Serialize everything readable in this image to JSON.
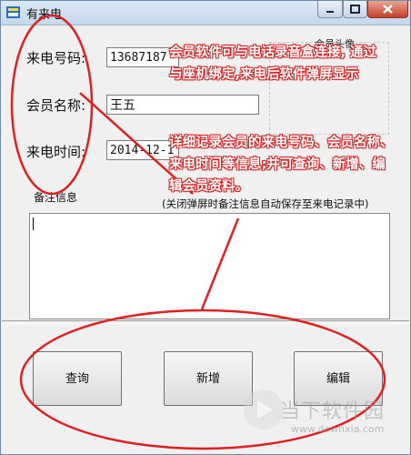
{
  "window": {
    "title": "有来电"
  },
  "fields": {
    "phone": {
      "label": "来电号码:",
      "value": "13687187"
    },
    "name": {
      "label": "会员名称:",
      "value": "王五"
    },
    "time": {
      "label": "来电时间:",
      "value": "2014-12-1"
    }
  },
  "avatar": {
    "label": "会员头像"
  },
  "remark": {
    "label": "备注信息",
    "hint": "(关闭弹屏时备注信息自动保存至来电记录中)",
    "value": ""
  },
  "buttons": {
    "query": "查询",
    "add": "新增",
    "edit": "编辑"
  },
  "annotations": {
    "note1": [
      "会员软件可与电话录音盒连接, 通过",
      "与座机绑定,来电后软件弹屏显示"
    ],
    "note2": [
      "详细记录会员的来电号码、会员名称、",
      "来电时间等信息;并可查询、新增、编",
      "辑会员资料。"
    ],
    "color": "#e02020"
  },
  "watermark": {
    "text": "当下软件园",
    "url": "www.downxia.com"
  }
}
